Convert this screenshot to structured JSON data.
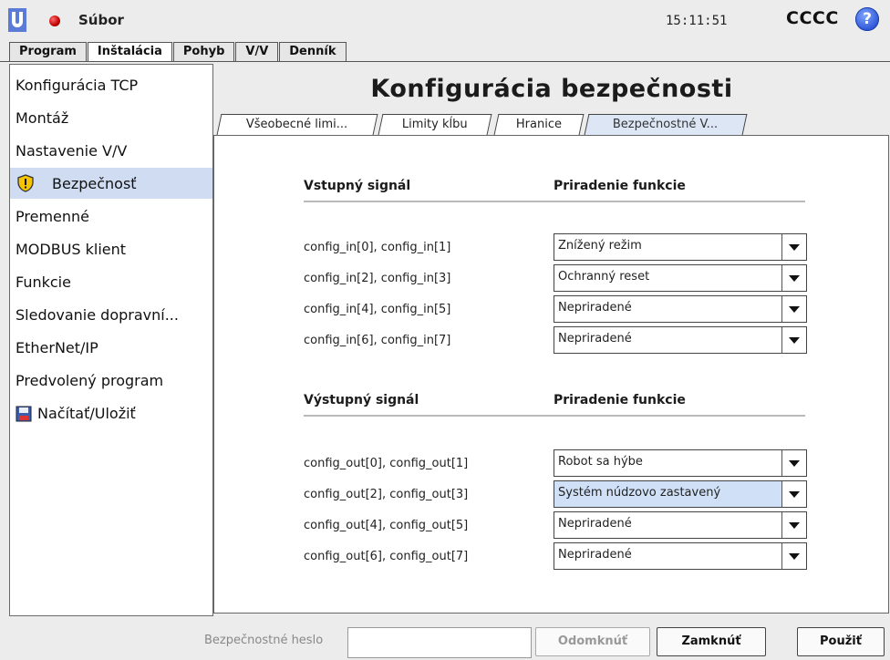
{
  "topbar": {
    "file_label": "Súbor",
    "time": "15:11:51",
    "robot_name": "CCCC",
    "help_glyph": "?"
  },
  "main_tabs": [
    {
      "label": "Program"
    },
    {
      "label": "Inštalácia",
      "active": true
    },
    {
      "label": "Pohyb"
    },
    {
      "label": "V/V"
    },
    {
      "label": "Denník"
    }
  ],
  "sidebar": {
    "items": [
      {
        "label": "Konfigurácia TCP"
      },
      {
        "label": "Montáž"
      },
      {
        "label": "Nastavenie V/V"
      },
      {
        "label": "Bezpečnosť",
        "icon": "shield-warning-icon",
        "selected": true
      },
      {
        "label": "Premenné"
      },
      {
        "label": "MODBUS klient"
      },
      {
        "label": "Funkcie"
      },
      {
        "label": "Sledovanie dopravní..."
      },
      {
        "label": "EtherNet/IP"
      },
      {
        "label": "Predvolený program"
      },
      {
        "label": "Načítať/Uložiť",
        "icon": "floppy-disk-icon"
      }
    ]
  },
  "main": {
    "title": "Konfigurácia bezpečnosti",
    "tabs": [
      {
        "label": "Všeobecné limi..."
      },
      {
        "label": "Limity kĺbu"
      },
      {
        "label": "Hranice"
      },
      {
        "label": "Bezpečnostné V...",
        "active": true
      }
    ],
    "inputs": {
      "col_signal": "Vstupný signál",
      "col_function": "Priradenie funkcie",
      "rows": [
        {
          "signal": "config_in[0], config_in[1]",
          "value": "Znížený režim"
        },
        {
          "signal": "config_in[2], config_in[3]",
          "value": "Ochranný reset"
        },
        {
          "signal": "config_in[4], config_in[5]",
          "value": "Nepriradené"
        },
        {
          "signal": "config_in[6], config_in[7]",
          "value": "Nepriradené"
        }
      ]
    },
    "outputs": {
      "col_signal": "Výstupný signál",
      "col_function": "Priradenie funkcie",
      "rows": [
        {
          "signal": "config_out[0], config_out[1]",
          "value": "Robot sa hýbe"
        },
        {
          "signal": "config_out[2], config_out[3]",
          "value": "Systém núdzovo zastavený",
          "highlighted": true
        },
        {
          "signal": "config_out[4], config_out[5]",
          "value": "Nepriradené"
        },
        {
          "signal": "config_out[6], config_out[7]",
          "value": "Nepriradené"
        }
      ]
    }
  },
  "footer": {
    "password_label": "Bezpečnostné heslo",
    "password_value": "",
    "unlock_label": "Odomknúť",
    "lock_label": "Zamknúť",
    "apply_label": "Použiť"
  },
  "colors": {
    "selected_bg": "#cfdcf2",
    "highlight_dropdown": "#cfe0f7",
    "status_dot": "#c00000",
    "help_icon": "#2e56d6"
  }
}
